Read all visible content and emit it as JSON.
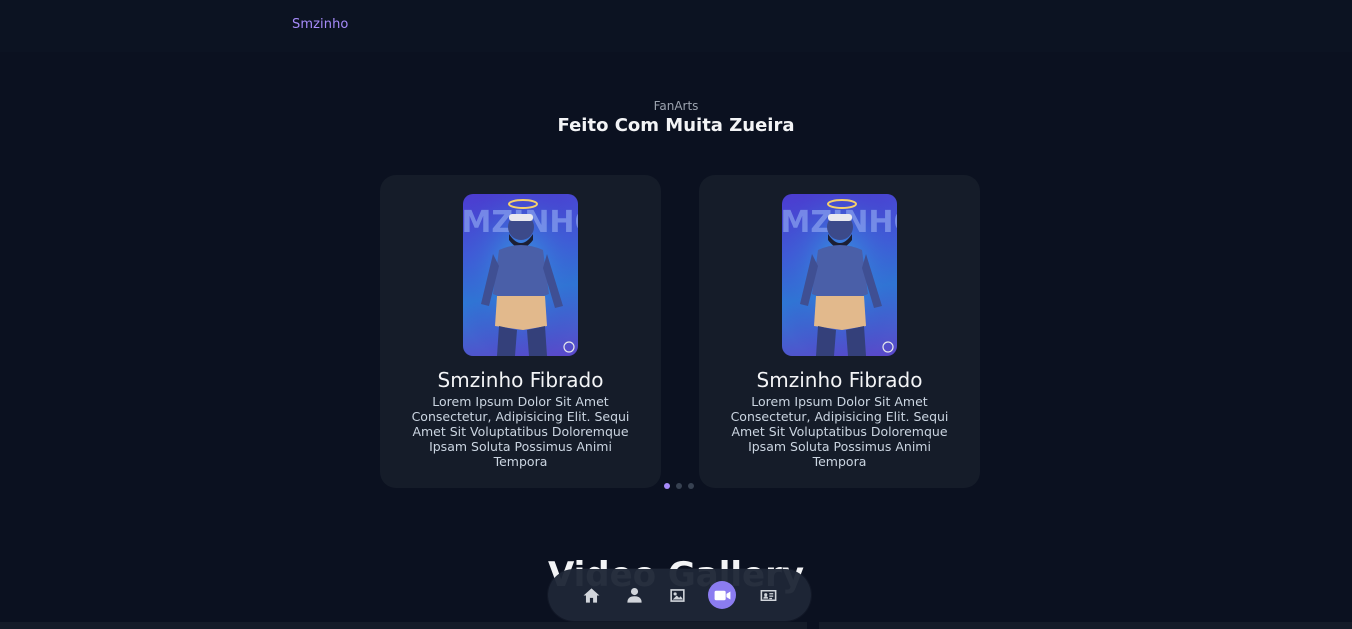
{
  "header": {
    "brand": "Smzinho"
  },
  "section": {
    "kicker": "FanArts",
    "title": "Feito Com Muita Zueira"
  },
  "cards": [
    {
      "image_text": "SMZINHO",
      "name": "Smzinho Fibrado",
      "description": "Lorem Ipsum Dolor Sit Amet Consectetur, Adipisicing Elit. Sequi Amet Sit Voluptatibus Doloremque Ipsam Soluta Possimus Animi Tempora"
    },
    {
      "image_text": "SMZINHO",
      "name": "Smzinho Fibrado",
      "description": "Lorem Ipsum Dolor Sit Amet Consectetur, Adipisicing Elit. Sequi Amet Sit Voluptatibus Doloremque Ipsam Soluta Possimus Animi Tempora"
    }
  ],
  "pagination": {
    "count": 3,
    "active": 1
  },
  "next_section": {
    "title": "Video Gallery"
  },
  "dock": {
    "items": [
      {
        "icon": "home-icon",
        "active": false
      },
      {
        "icon": "user-icon",
        "active": false
      },
      {
        "icon": "image-icon",
        "active": false
      },
      {
        "icon": "video-icon",
        "active": true
      },
      {
        "icon": "contact-card-icon",
        "active": false
      }
    ]
  },
  "colors": {
    "background": "#0b1120",
    "card": "#151c29",
    "accent": "#a78bfa",
    "dock_active": "#8b7cf0"
  }
}
